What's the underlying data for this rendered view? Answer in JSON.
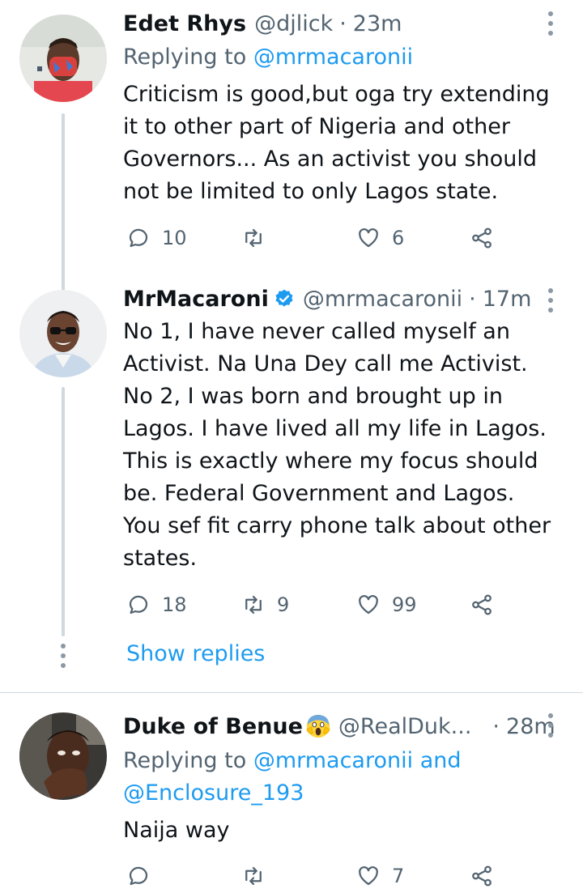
{
  "tweets": [
    {
      "name": "Edet Rhys",
      "handle": "@djlick",
      "separator": "·",
      "time": "23m",
      "reply_prefix": "Replying to ",
      "reply_to": "@mrmacaronii",
      "lines": [
        "Criticism is good,but oga try extending",
        "it to other part of Nigeria and other",
        "Governors... As an activist you should",
        "not be limited to only Lagos state."
      ],
      "replies": "10",
      "retweets": "",
      "likes": "6"
    },
    {
      "name": "MrMacaroni",
      "verified": true,
      "handle": "@mrmacaronii",
      "separator": "·",
      "time": "17m",
      "lines": [
        "No 1, I have never called myself an",
        "Activist. Na Una Dey call me Activist.",
        "No 2, I was born and brought up in",
        "Lagos. I have lived all my life in Lagos.",
        "This is exactly where my focus should",
        "be. Federal Government and Lagos.",
        "You sef fit carry phone talk about other",
        "states."
      ],
      "replies": "18",
      "retweets": "9",
      "likes": "99"
    },
    {
      "name": "Duke of Benue",
      "emoji": "screaming-face-emoji",
      "handle": "@RealDuk...",
      "separator": "·",
      "time": "28m",
      "reply_prefix": "Replying to ",
      "reply_to": "@mrmacaronii",
      "reply_and": " and",
      "reply_to_2": "@Enclosure_193",
      "lines": [
        "Naija way"
      ],
      "replies": "",
      "retweets": "",
      "likes": "7"
    }
  ],
  "show_replies": "Show replies",
  "colors": {
    "link": "#1d9bf0",
    "secondary_text": "#536471",
    "primary_text": "#0f1419",
    "thread_line": "#cfd9de",
    "verified": "#1d9bf0"
  }
}
